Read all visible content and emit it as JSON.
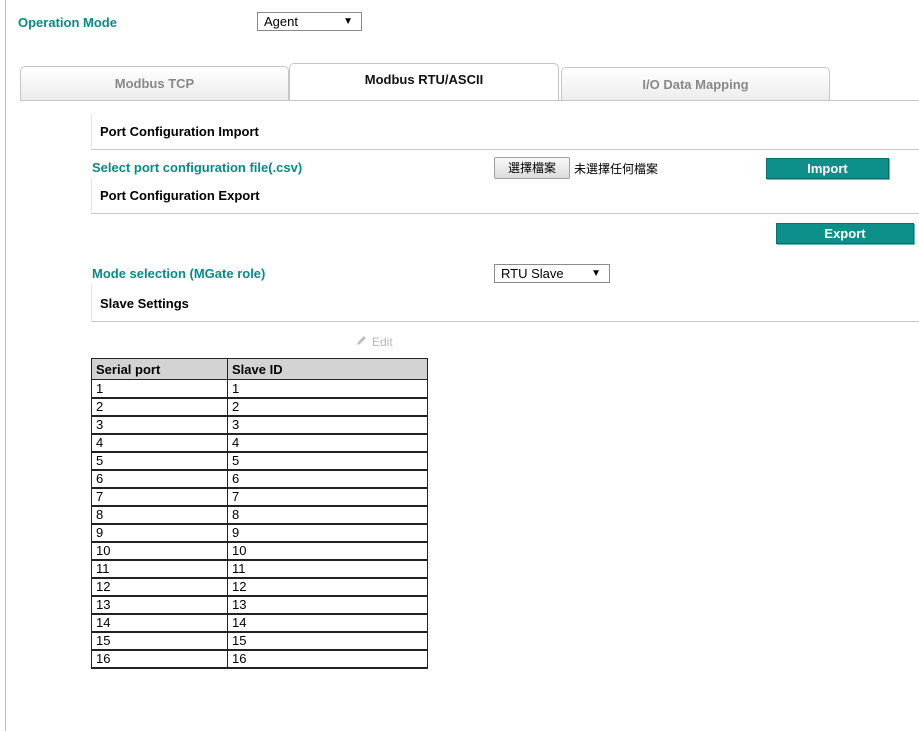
{
  "operation_mode": {
    "label": "Operation Mode",
    "value": "Agent"
  },
  "tabs": [
    {
      "label": "Modbus TCP"
    },
    {
      "label": "Modbus RTU/ASCII"
    },
    {
      "label": "I/O Data Mapping"
    }
  ],
  "import": {
    "section_title": "Port Configuration Import",
    "select_label": "Select port configuration file(.csv)",
    "file_button": "選擇檔案",
    "file_status": "未選擇任何檔案",
    "import_button": "Import"
  },
  "export": {
    "section_title": "Port Configuration Export",
    "export_button": "Export"
  },
  "mode_selection": {
    "label": "Mode selection (MGate role)",
    "value": "RTU Slave"
  },
  "slave_settings": {
    "section_title": "Slave Settings",
    "edit_label": "Edit",
    "columns": [
      "Serial port",
      "Slave ID"
    ],
    "rows": [
      [
        "1",
        "1"
      ],
      [
        "2",
        "2"
      ],
      [
        "3",
        "3"
      ],
      [
        "4",
        "4"
      ],
      [
        "5",
        "5"
      ],
      [
        "6",
        "6"
      ],
      [
        "7",
        "7"
      ],
      [
        "8",
        "8"
      ],
      [
        "9",
        "9"
      ],
      [
        "10",
        "10"
      ],
      [
        "11",
        "11"
      ],
      [
        "12",
        "12"
      ],
      [
        "13",
        "13"
      ],
      [
        "14",
        "14"
      ],
      [
        "15",
        "15"
      ],
      [
        "16",
        "16"
      ]
    ]
  },
  "colors": {
    "accent": "#0a8a85",
    "button": "#0d8f8a",
    "header_bg": "#d3d3d3"
  },
  "icons": {
    "dropdown": "triangle-down",
    "edit": "pencil"
  }
}
